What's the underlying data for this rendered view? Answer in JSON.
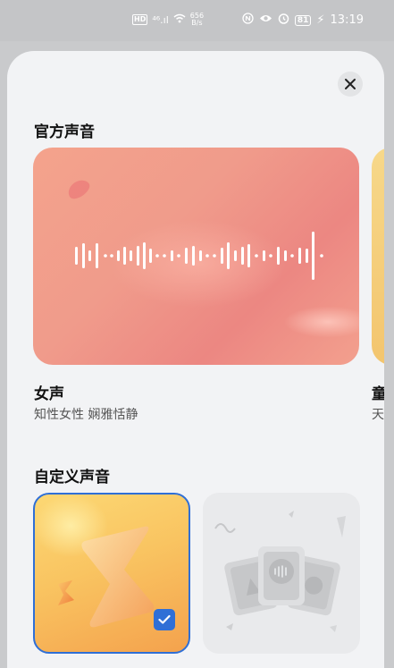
{
  "status_bar": {
    "hd": "HD",
    "signal": "⁴⁶.ıl",
    "net_speed_value": "656",
    "net_speed_unit": "B/s",
    "battery": "81",
    "time": "13:19"
  },
  "sheet": {
    "official_title": "官方声音",
    "official_voices": [
      {
        "name": "女声",
        "desc": "知性女性 娴雅恬静"
      },
      {
        "name": "童",
        "desc": "天"
      }
    ],
    "custom_title": "自定义声音",
    "custom_cards": [
      {
        "name": "custom-voice-selected",
        "selected": true
      },
      {
        "name": "add-custom-voice",
        "selected": false
      }
    ]
  },
  "colors": {
    "accent": "#2f6fd6",
    "sheet_bg": "#f2f3f5",
    "female_card": "#f09b8b",
    "custom_card": "#f9c461"
  }
}
